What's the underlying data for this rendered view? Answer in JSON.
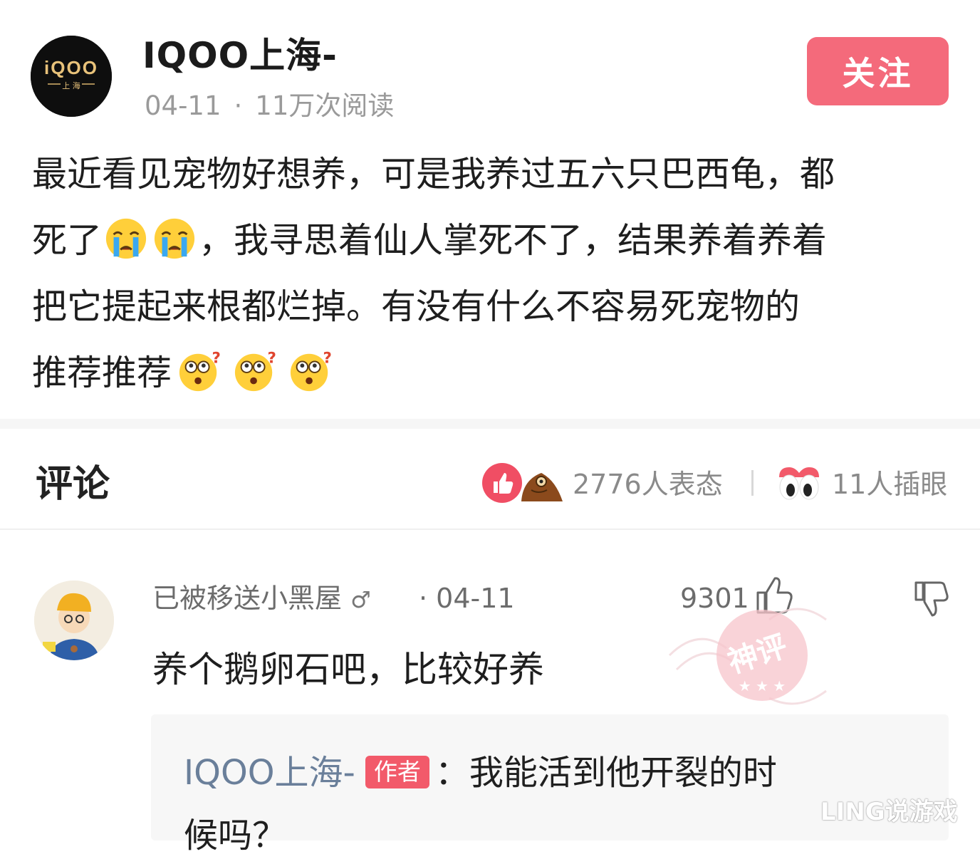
{
  "post": {
    "author_name": "IQOO上海-",
    "avatar_logo_text": "iQOO",
    "avatar_logo_sub": "上 海",
    "date": "04-11",
    "meta_separator": "·",
    "reads": "11万次阅读",
    "follow_label": "关注",
    "body_lines": [
      "最近看见宠物好想养，可是我养过五六只巴西龟，都",
      "死了",
      "，我寻思着仙人掌死不了，结果养着养着",
      "把它提起来根都烂掉。有没有什么不容易死宠物的",
      "推荐推荐"
    ],
    "emoji": {
      "crying": "crying-face",
      "confused": "confused-face"
    }
  },
  "comments_header": {
    "title": "评论",
    "reactions": "2776人表态",
    "watchers": "11人插眼"
  },
  "comment": {
    "user": "已被移送小黑屋",
    "gender_symbol": "♂",
    "date": "· 04-11",
    "likes": "9301",
    "text": "养个鹅卵石吧，比较好养",
    "stamp_text": "神评",
    "reply": {
      "author": "IQOO上海-",
      "badge": "作者",
      "text_line1": "：我能活到他开裂的时",
      "text_line2": "候吗？"
    }
  },
  "watermark": "LING说游戏",
  "colors": {
    "follow_button": "#f46a7b",
    "author_badge": "#f25a6a",
    "reply_author": "#6a7f9a",
    "meta_gray": "#9a9a9a"
  }
}
